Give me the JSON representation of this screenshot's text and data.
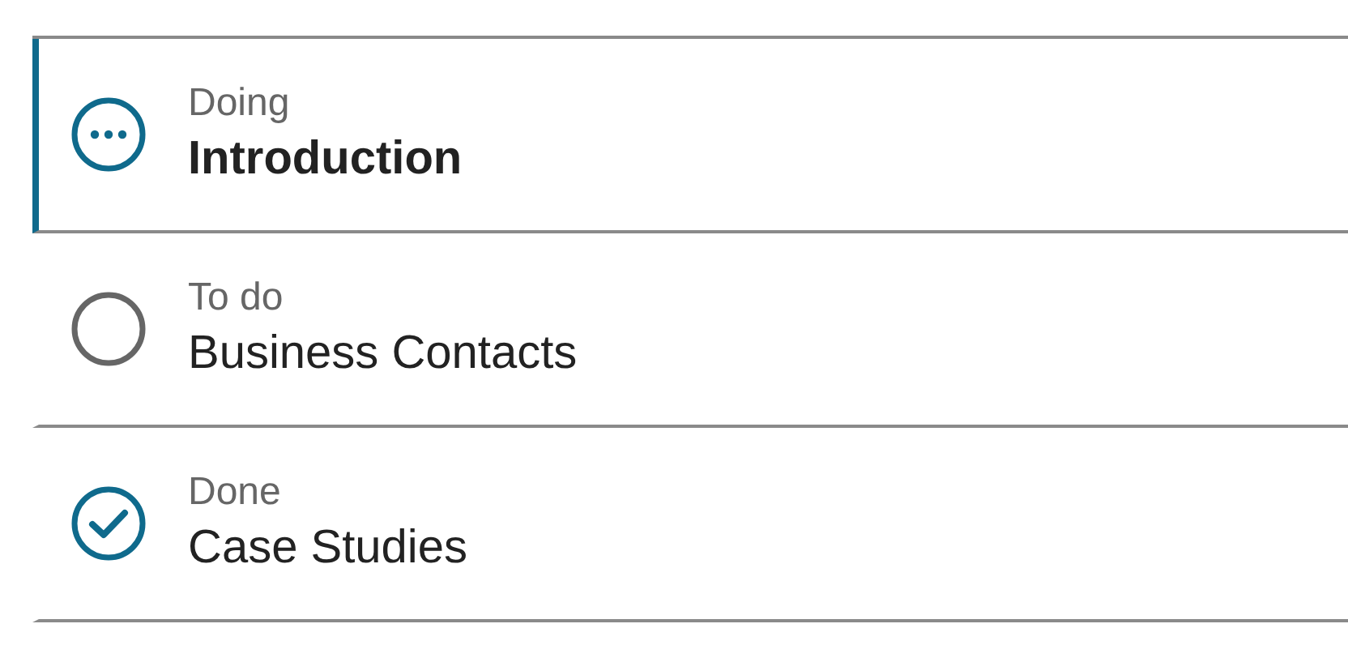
{
  "items": [
    {
      "status": "Doing",
      "title": "Introduction",
      "kind": "doing",
      "selected": true
    },
    {
      "status": "To do",
      "title": "Business Contacts",
      "kind": "todo",
      "selected": false
    },
    {
      "status": "Done",
      "title": "Case Studies",
      "kind": "done",
      "selected": false
    }
  ]
}
